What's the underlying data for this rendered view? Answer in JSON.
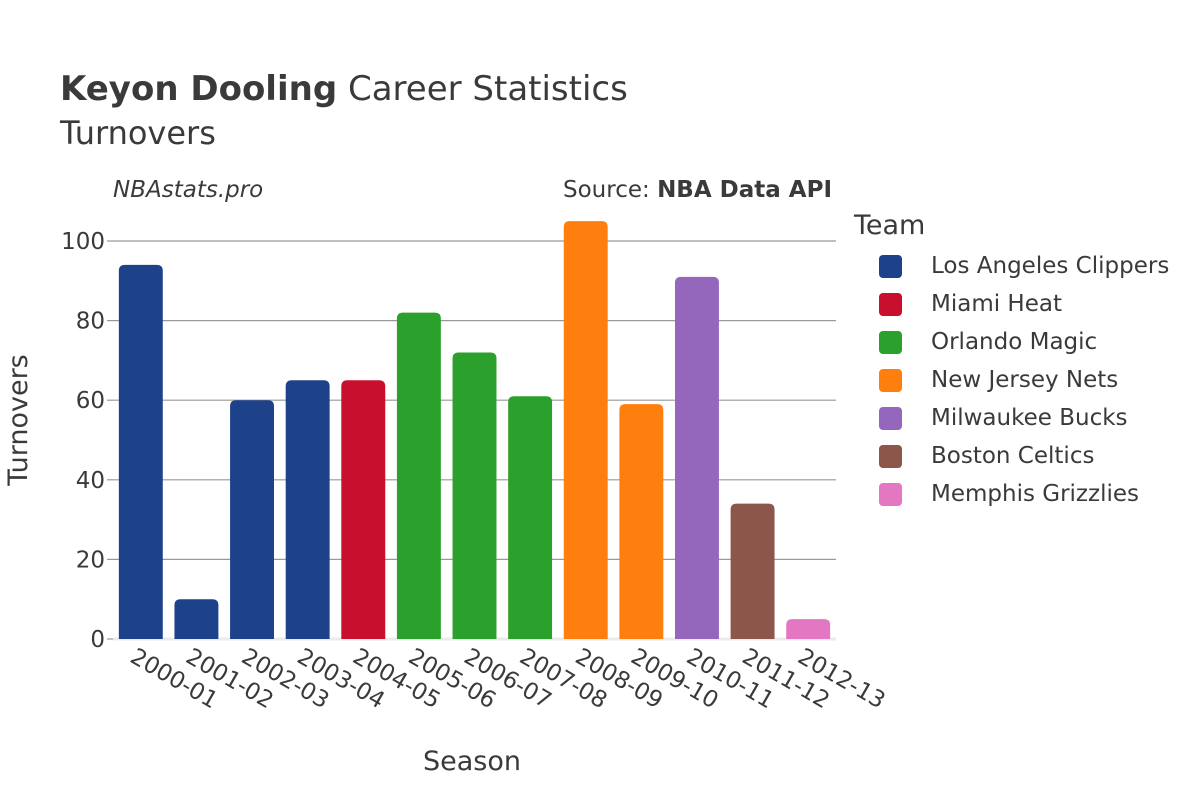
{
  "header": {
    "title_bold": "Keyon Dooling",
    "title_rest": " Career Statistics",
    "subtitle": "Turnovers",
    "brand": "NBAstats.pro",
    "source_prefix": "Source: ",
    "source_bold": "NBA Data API"
  },
  "legend": {
    "title": "Team",
    "items": [
      {
        "label": "Los Angeles Clippers",
        "color": "#1d428a"
      },
      {
        "label": "Miami Heat",
        "color": "#c8102e"
      },
      {
        "label": "Orlando Magic",
        "color": "#2ca02c"
      },
      {
        "label": "New Jersey Nets",
        "color": "#ff7f0e"
      },
      {
        "label": "Milwaukee Bucks",
        "color": "#9467bd"
      },
      {
        "label": "Boston Celtics",
        "color": "#8c564b"
      },
      {
        "label": "Memphis Grizzlies",
        "color": "#e377c2"
      }
    ]
  },
  "chart_data": {
    "type": "bar",
    "title": "Keyon Dooling Career Statistics",
    "subtitle": "Turnovers",
    "xlabel": "Season",
    "ylabel": "Turnovers",
    "ylim": [
      0,
      108
    ],
    "yticks": [
      0,
      20,
      40,
      60,
      80,
      100
    ],
    "grid": true,
    "legend_position": "right",
    "categories": [
      "2000-01",
      "2001-02",
      "2002-03",
      "2003-04",
      "2004-05",
      "2005-06",
      "2006-07",
      "2007-08",
      "2008-09",
      "2009-10",
      "2010-11",
      "2011-12",
      "2012-13"
    ],
    "values": [
      94,
      10,
      60,
      65,
      65,
      82,
      72,
      61,
      105,
      59,
      91,
      34,
      5
    ],
    "teams": [
      "Los Angeles Clippers",
      "Los Angeles Clippers",
      "Los Angeles Clippers",
      "Los Angeles Clippers",
      "Miami Heat",
      "Orlando Magic",
      "Orlando Magic",
      "Orlando Magic",
      "New Jersey Nets",
      "New Jersey Nets",
      "Milwaukee Bucks",
      "Boston Celtics",
      "Memphis Grizzlies"
    ]
  }
}
